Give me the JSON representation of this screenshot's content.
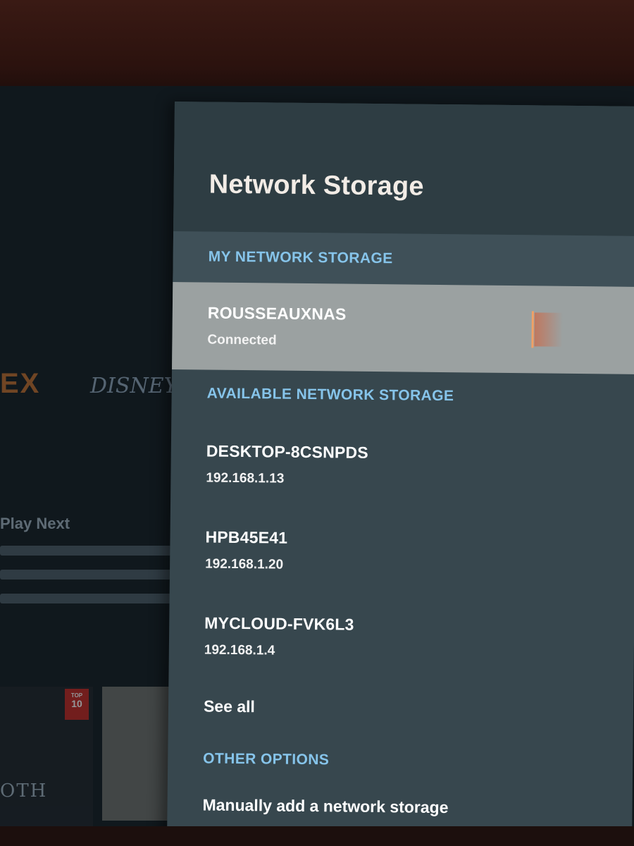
{
  "background": {
    "logo_left": "EX",
    "logo_disney": "DISNEY+",
    "play_next_title": "Play Next",
    "badge_top10": {
      "top": "TOP",
      "num": "10"
    },
    "tile_text": "OTH"
  },
  "panel": {
    "title": "Network Storage",
    "my_section": {
      "header": "MY NETWORK STORAGE",
      "items": [
        {
          "name": "ROUSSEAUXNAS",
          "status": "Connected",
          "selected": true
        }
      ]
    },
    "available_section": {
      "header": "AVAILABLE NETWORK STORAGE",
      "devices": [
        {
          "name": "DESKTOP-8CSNPDS",
          "ip": "192.168.1.13"
        },
        {
          "name": "HPB45E41",
          "ip": "192.168.1.20"
        },
        {
          "name": "MYCLOUD-FVK6L3",
          "ip": "192.168.1.4"
        }
      ],
      "see_all_label": "See all"
    },
    "other_section": {
      "header": "OTHER OPTIONS",
      "items": [
        {
          "label": "Manually add a network storage"
        }
      ]
    }
  },
  "colors": {
    "panel_bg": "#37474e",
    "header_bg": "#2e3d43",
    "section_accent": "#86c4ea",
    "selected_bg": "#9ba1a1",
    "focus_indicator": "#f1a064"
  }
}
